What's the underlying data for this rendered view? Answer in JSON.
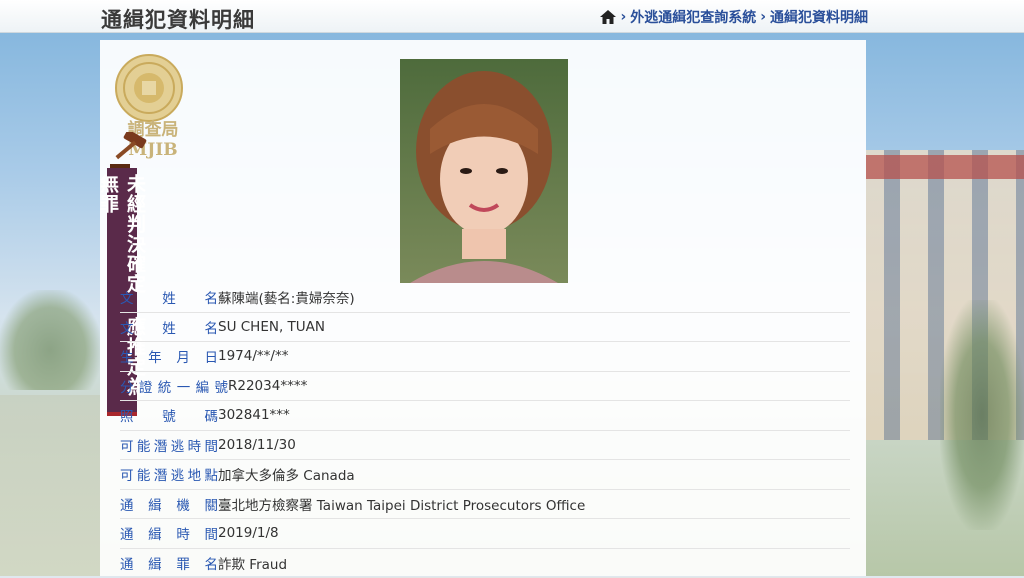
{
  "header": {
    "title": "通緝犯資料明細",
    "breadcrumb": [
      {
        "label": "外逃通緝犯查詢系統"
      },
      {
        "label": "通緝犯資料明細"
      }
    ]
  },
  "logo": {
    "text": "調查局",
    "text2": "MJIB"
  },
  "banner": {
    "text": "未經判決確定 應推定為無罪"
  },
  "fields": [
    {
      "label": "文 姓 名",
      "value": "蘇陳端(藝名:貴婦奈奈)"
    },
    {
      "label": "文 姓 名",
      "value": "SU CHEN, TUAN"
    },
    {
      "label": "生年月日",
      "value": "1974/**/**"
    },
    {
      "label": "分證統一編號",
      "value": "R22034****"
    },
    {
      "label": "照 號 碼",
      "value": "302841***"
    },
    {
      "label": "可能潛逃時間",
      "value": "2018/11/30"
    },
    {
      "label": "可能潛逃地點",
      "value": "加拿大多倫多 Canada"
    },
    {
      "label": "通 緝 機 關",
      "value": "臺北地方檢察署 Taiwan Taipei District Prosecutors Office"
    },
    {
      "label": "通 緝 時 間",
      "value": "2019/1/8"
    },
    {
      "label": "通 緝 罪 名",
      "value": "詐欺 Fraud"
    }
  ],
  "icons": {
    "home": "home-icon",
    "seal": "mjib-seal-icon",
    "gavel": "gavel-icon"
  }
}
